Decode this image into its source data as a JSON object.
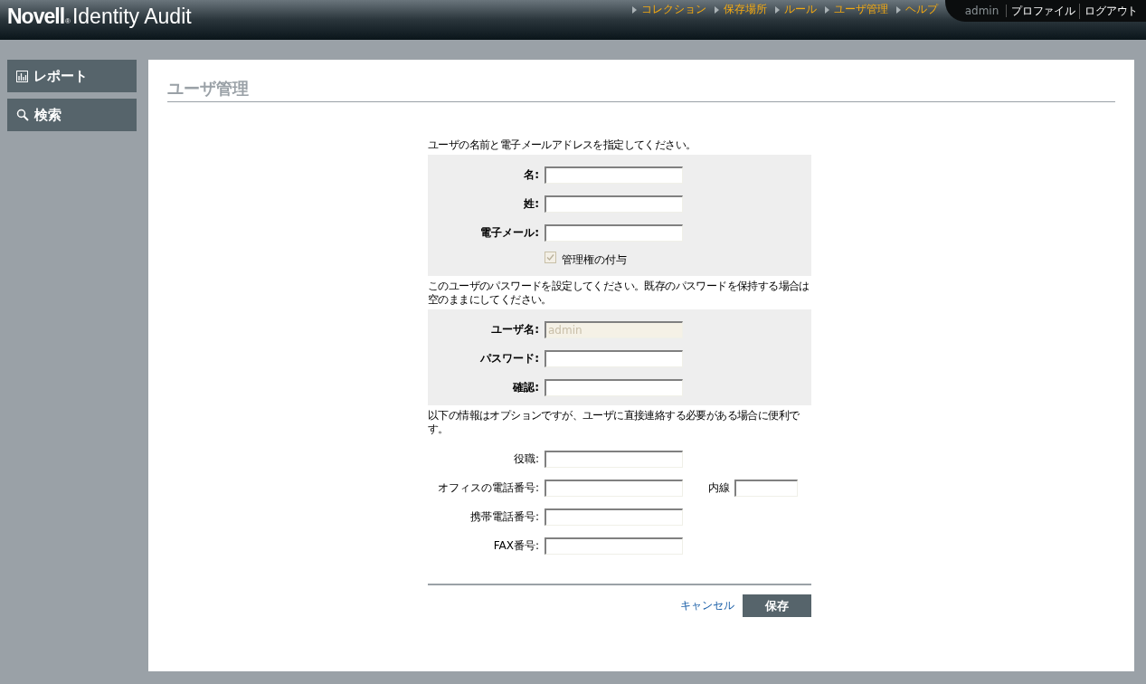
{
  "header": {
    "brand": "Novell",
    "brand_mark": "®",
    "product": "Identity Audit",
    "nav": [
      {
        "label": "コレクション"
      },
      {
        "label": "保存場所"
      },
      {
        "label": "ルール"
      },
      {
        "label": "ユーザ管理"
      },
      {
        "label": "ヘルプ"
      }
    ],
    "user": "admin",
    "links": [
      {
        "label": "プロファイル"
      },
      {
        "label": "ログアウト"
      }
    ]
  },
  "sidebar": {
    "items": [
      {
        "label": "レポート",
        "kind": "chart"
      },
      {
        "label": "検索",
        "kind": "search"
      }
    ]
  },
  "page_title": "ユーザ管理",
  "sections": [
    {
      "instruction": "ユーザの名前と電子メールアドレスを指定してください。",
      "shaded": true,
      "fields": [
        {
          "kind": "text",
          "label": "名:"
        },
        {
          "kind": "text",
          "label": "姓:"
        },
        {
          "kind": "text",
          "label": "電子メール:"
        },
        {
          "kind": "checkbox",
          "label": "管理権の付与",
          "checked": true,
          "disabled": true
        }
      ]
    },
    {
      "instruction": "このユーザのパスワードを設定してください。既存のパスワードを保持する場合は空のままにしてください。",
      "shaded": true,
      "fields": [
        {
          "kind": "text",
          "label": "ユーザ名:",
          "value": "admin",
          "disabled": true
        },
        {
          "kind": "text",
          "label": "パスワード:"
        },
        {
          "kind": "text",
          "label": "確認:"
        }
      ]
    },
    {
      "instruction": "以下の情報はオプションですが、ユーザに直接連絡する必要がある場合に便利です。",
      "shaded": false,
      "fields": [
        {
          "kind": "text",
          "label": "役職:"
        },
        {
          "kind": "text",
          "label": "オフィスの電話番号:",
          "extra": {
            "label": "内線"
          }
        },
        {
          "kind": "text",
          "label": "携帯電話番号:"
        },
        {
          "kind": "text",
          "label": "FAX番号:"
        }
      ]
    }
  ],
  "actions": {
    "cancel": "キャンセル",
    "save": "保存"
  }
}
